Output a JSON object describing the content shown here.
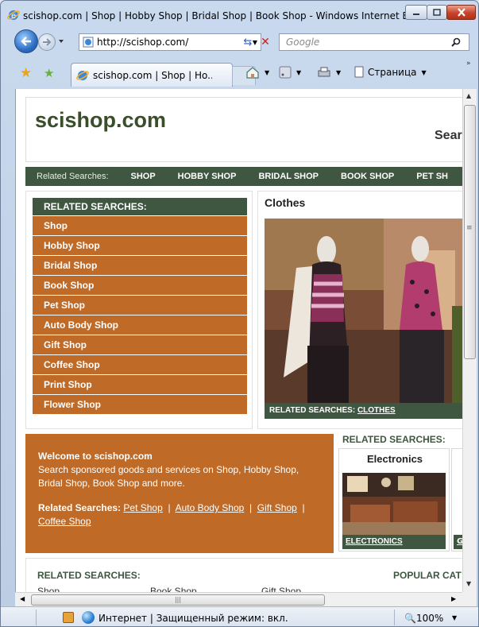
{
  "window": {
    "title": "scishop.com | Shop | Hobby Shop | Bridal Shop | Book Shop - Windows Internet Ex..."
  },
  "address": {
    "url": "http://scishop.com/",
    "search_placeholder": "Google"
  },
  "toolbar": {
    "tab_title": "scishop.com | Shop | Ho...",
    "page_menu": "Страница"
  },
  "page": {
    "logo": "scishop.com",
    "search_label": "Sear",
    "green_bar": {
      "label": "Related Searches:",
      "items": [
        "SHOP",
        "HOBBY SHOP",
        "BRIDAL SHOP",
        "BOOK SHOP",
        "PET SH"
      ]
    },
    "related": {
      "heading": "RELATED SEARCHES:",
      "items": [
        "Shop",
        "Hobby Shop",
        "Bridal Shop",
        "Book Shop",
        "Pet Shop",
        "Auto Body Shop",
        "Gift Shop",
        "Coffee Shop",
        "Print Shop",
        "Flower Shop"
      ]
    },
    "clothes": {
      "title": "Clothes",
      "caption_label": "RELATED SEARCHES:",
      "caption_link": "CLOTHES"
    },
    "welcome": {
      "title": "Welcome to scishop.com",
      "body": "Search sponsored goods and services on Shop,  Hobby Shop,  Bridal Shop,  Book Shop and more.",
      "rs_label": "Related Searches:",
      "links": [
        "Pet Shop",
        "Auto Body Shop",
        "Gift Shop",
        "Coffee Shop"
      ],
      "separator": "|"
    },
    "related2": {
      "heading": "RELATED SEARCHES:",
      "card_title": "Electronics",
      "card_caption": "ELECTRONICS",
      "card2_caption": "G"
    },
    "bottom": {
      "heading": "RELATED SEARCHES:",
      "popular": "POPULAR CAT",
      "links": [
        "Shop",
        "Book Shop",
        "Gift Shop"
      ]
    }
  },
  "status": {
    "text": "Интернет | Защищенный режим: вкл.",
    "zoom": "100%"
  },
  "colors": {
    "green": "#3f5641",
    "orange": "#bf6a26"
  }
}
